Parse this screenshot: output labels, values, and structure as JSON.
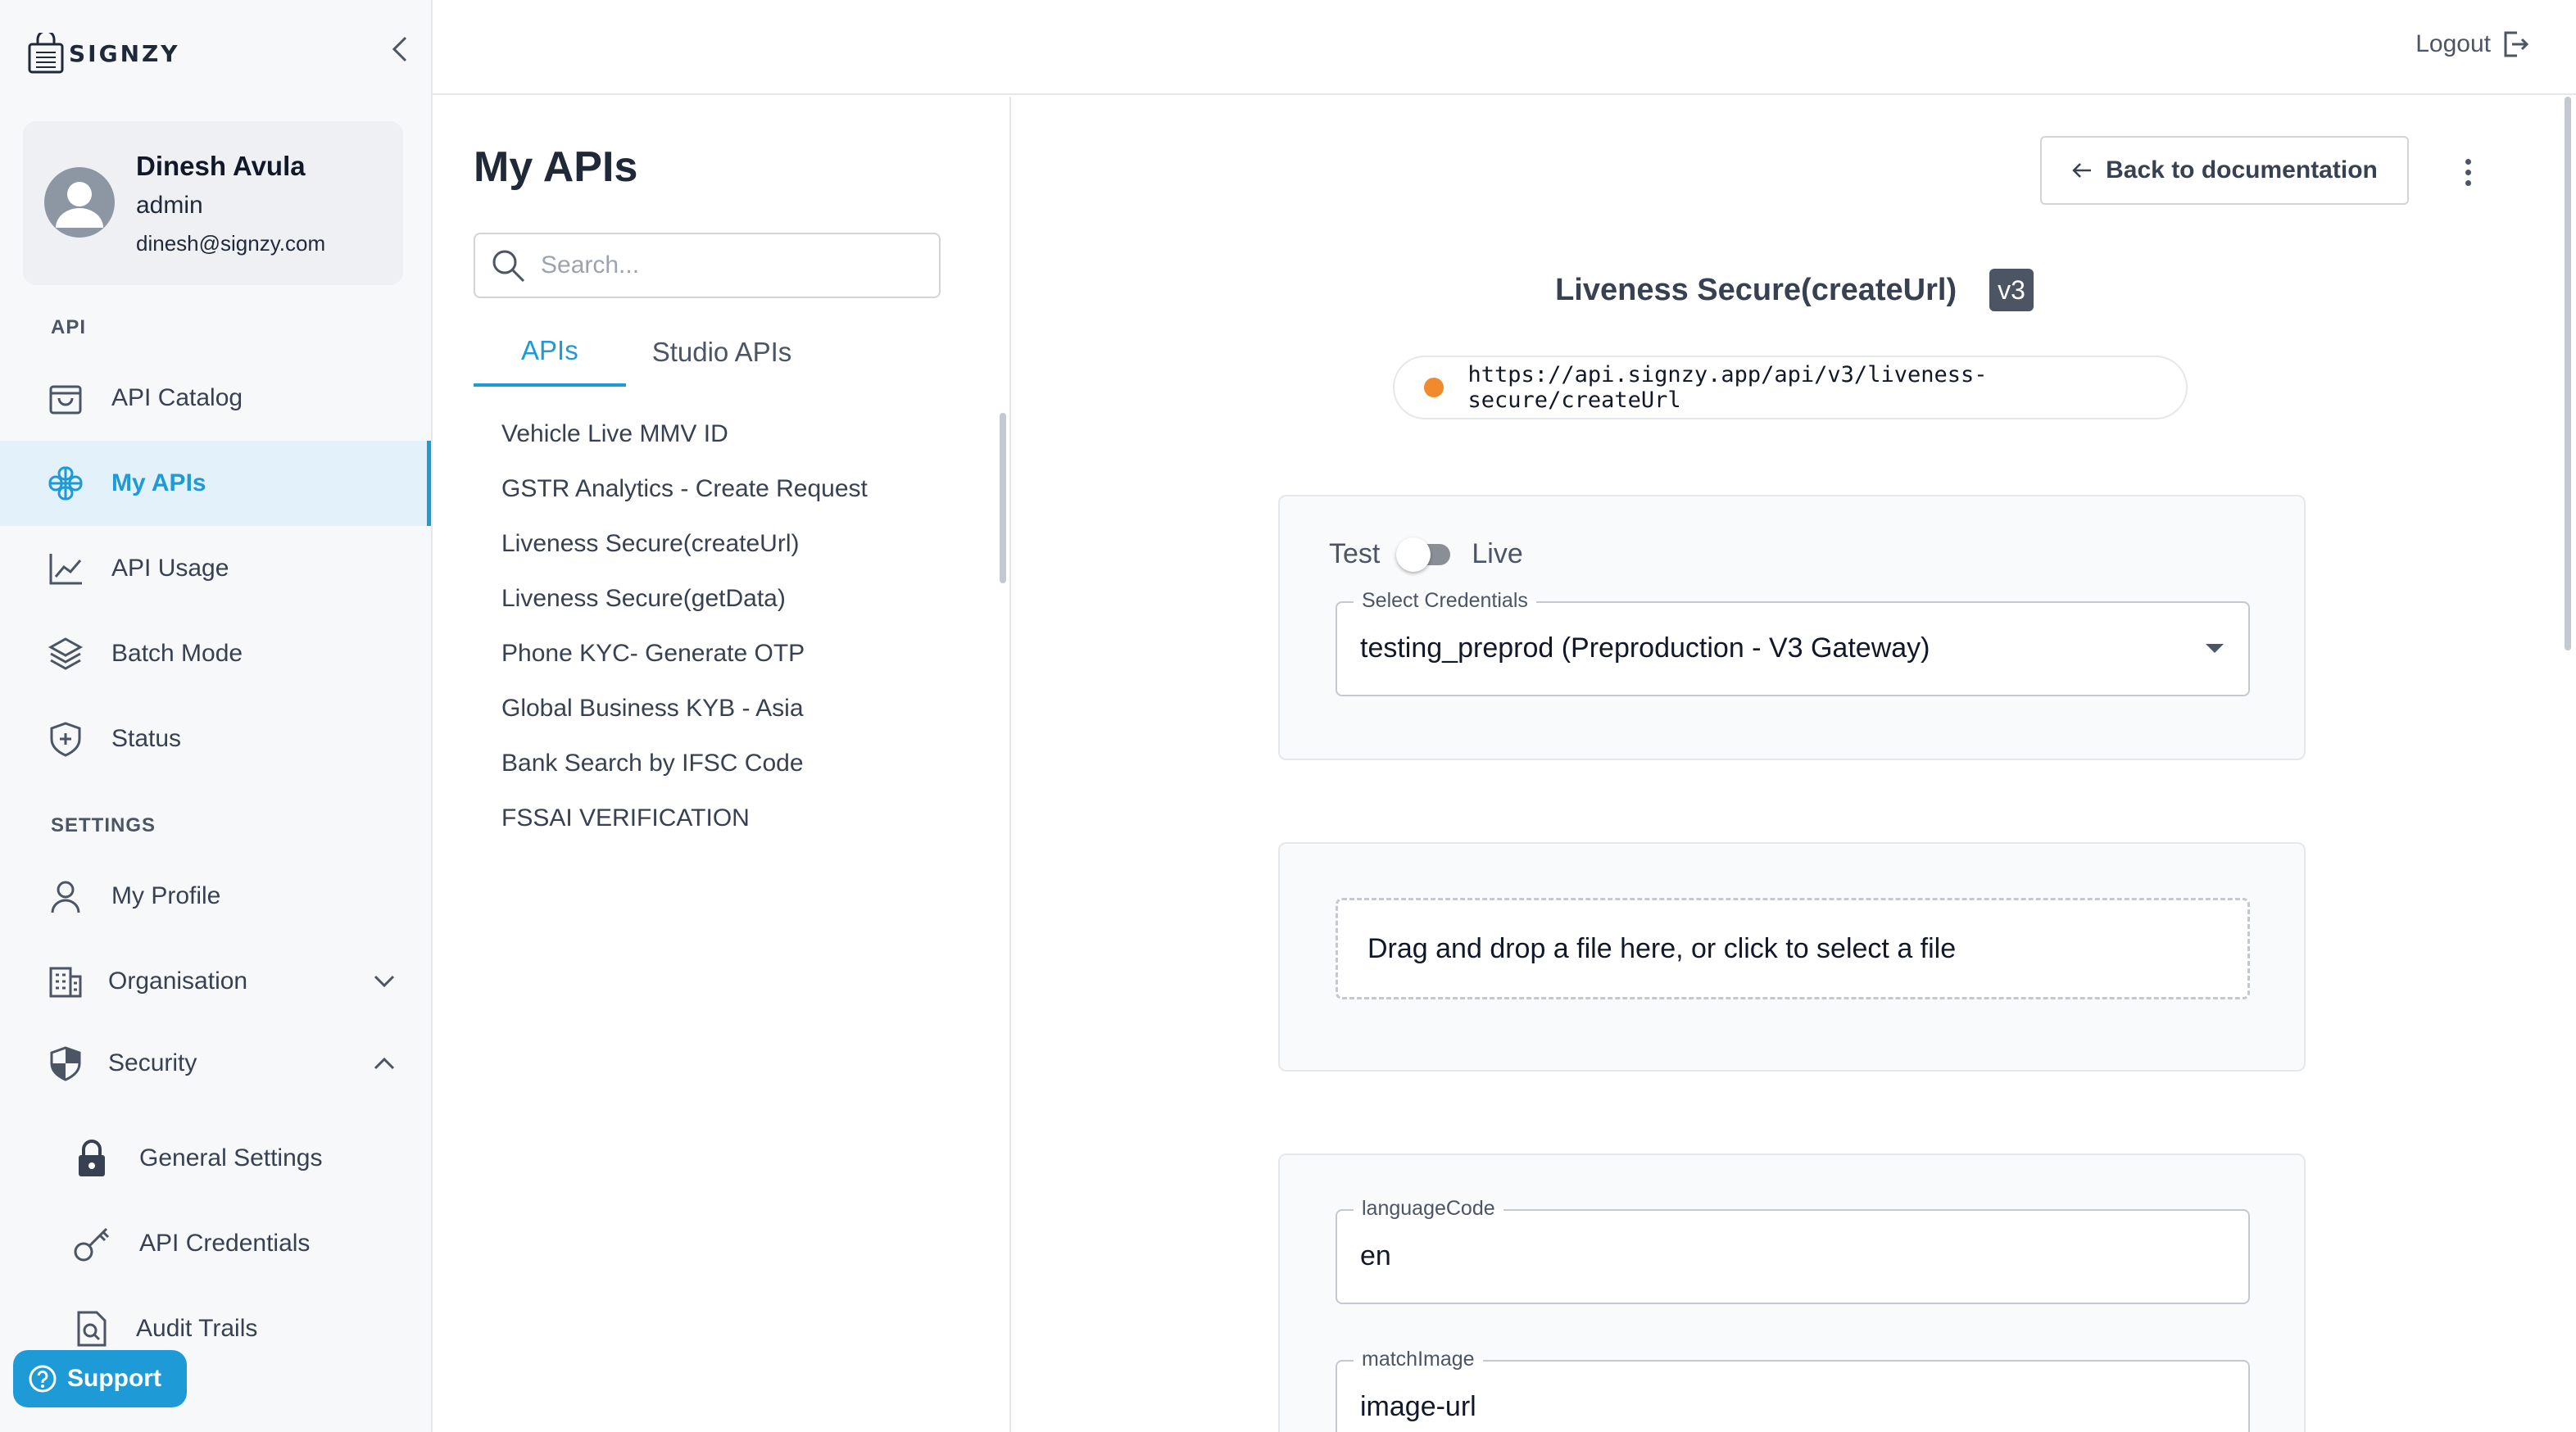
{
  "brand": {
    "name": "SIGNZY"
  },
  "user": {
    "name": "Dinesh Avula",
    "role": "admin",
    "email": "dinesh@signzy.com"
  },
  "sidebar": {
    "api_section": "API",
    "api_items": [
      {
        "label": "API Catalog",
        "icon": "shopping-bag-icon"
      },
      {
        "label": "My APIs",
        "icon": "api-icon",
        "active": true
      },
      {
        "label": "API Usage",
        "icon": "line-chart-icon"
      },
      {
        "label": "Batch Mode",
        "icon": "layers-icon"
      },
      {
        "label": "Status",
        "icon": "shield-plus-icon"
      }
    ],
    "settings_section": "SETTINGS",
    "settings_items": [
      {
        "label": "My Profile",
        "icon": "person-icon"
      },
      {
        "label": "Organisation",
        "icon": "building-icon",
        "expanded": false
      },
      {
        "label": "Security",
        "icon": "shield-icon",
        "expanded": true
      }
    ],
    "security_items": [
      {
        "label": "General Settings",
        "icon": "lock-icon"
      },
      {
        "label": "API Credentials",
        "icon": "key-icon"
      },
      {
        "label": "Audit Trails",
        "icon": "document-search-icon"
      }
    ],
    "support_label": "Support"
  },
  "topbar": {
    "logout_label": "Logout"
  },
  "list_panel": {
    "title": "My APIs",
    "search_placeholder": "Search...",
    "tabs": [
      {
        "label": "APIs",
        "active": true
      },
      {
        "label": "Studio APIs",
        "active": false
      }
    ],
    "items": [
      "Vehicle Live MMV ID",
      "GSTR Analytics - Create Request",
      "Liveness Secure(createUrl)",
      "Liveness Secure(getData)",
      "Phone KYC- Generate OTP",
      "Global Business KYB - Asia",
      "Bank Search by IFSC Code",
      "FSSAI VERIFICATION"
    ]
  },
  "main": {
    "back_label": "Back to documentation",
    "api_title": "Liveness Secure(createUrl)",
    "version": "v3",
    "endpoint_url": "https://api.signzy.app/api/v3/liveness-secure/createUrl",
    "status_color": "#f08a2c",
    "env_test_label": "Test",
    "env_live_label": "Live",
    "credentials": {
      "label": "Select Credentials",
      "value": "testing_preprod (Preproduction - V3 Gateway)"
    },
    "dropzone_text": "Drag and drop a file here, or click to select a file",
    "params": [
      {
        "label": "languageCode",
        "value": "en"
      },
      {
        "label": "matchImage",
        "value": "image-url"
      }
    ]
  },
  "colors": {
    "accent": "#1e9bd7",
    "active_bg": "#e3f1fb"
  }
}
